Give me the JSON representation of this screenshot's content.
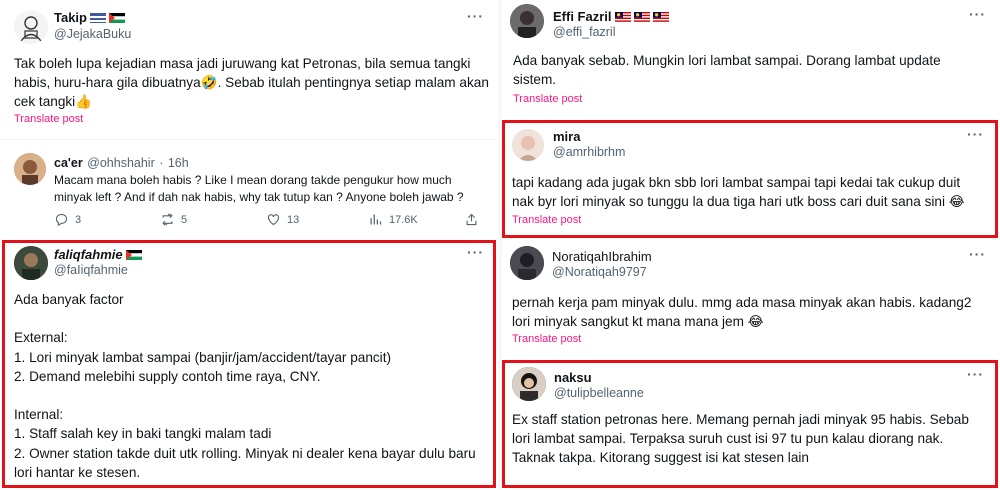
{
  "left": {
    "tweet1": {
      "name": "Takip",
      "handle": "@JejakaBuku",
      "body": "Tak boleh lupa kejadian masa jadi juruwang kat Petronas, bila semua tangki habis, huru-hara gila dibuatnya🤣. Sebab itulah pentingnya setiap malam akan cek tangki👍",
      "translate": "Translate post"
    },
    "reply": {
      "name": "ca'er",
      "handle": "@ohhshahir",
      "dot": "·",
      "time": "16h",
      "body": "Macam mana boleh habis ? Like I mean dorang takde pengukur how much minyak left ? And if dah nak habis, why tak tutup kan ? Anyone boleh jawab ?",
      "stats": {
        "replies": "3",
        "reposts": "5",
        "likes": "13",
        "views": "17.6K"
      }
    },
    "tweet2": {
      "name": "faliqfahmie",
      "handle": "@faIiqfahmie",
      "body": "Ada banyak factor\n\nExternal:\n1. Lori minyak lambat sampai (banjir/jam/accident/tayar pancit)\n2. Demand melebihi supply contoh time raya, CNY.\n\nInternal:\n1. Staff salah key in baki tangki malam tadi\n2. Owner station takde duit utk rolling. Minyak ni dealer kena bayar dulu baru lori hantar ke stesen."
    }
  },
  "right": {
    "tweet1": {
      "name": "Effi Fazril",
      "handle": "@effi_fazril",
      "body": "Ada banyak sebab. Mungkin lori lambat sampai. Dorang lambat update sistem.",
      "translate": "Translate post"
    },
    "tweet2": {
      "name": "mira",
      "handle": "@amrhibrhm",
      "body": "tapi kadang ada jugak bkn sbb lori lambat sampai tapi kedai tak cukup duit nak byr lori minyak so tunggu la dua tiga hari utk boss cari duit sana sini 😂",
      "translate": "Translate post"
    },
    "tweet3": {
      "name": "NoratiqahIbrahim",
      "handle": "@Noratiqah9797",
      "body": "pernah kerja pam minyak dulu. mmg ada masa minyak akan habis. kadang2 lori minyak sangkut kt mana mana jem 😂",
      "translate": "Translate post"
    },
    "tweet4": {
      "name": "naksu",
      "handle": "@tulipbelleanne",
      "body": "Ex staff station petronas here. Memang pernah jadi minyak 95 habis. Sebab lori lambat sampai. Terpaksa suruh cust isi 97 tu pun kalau diorang nak. Taknak takpa. Kitorang suggest isi kat stesen lain"
    }
  },
  "more_label": "···",
  "colors": {
    "highlight": "#e3111a",
    "translate": "#f91880",
    "secondary": "#536471"
  }
}
